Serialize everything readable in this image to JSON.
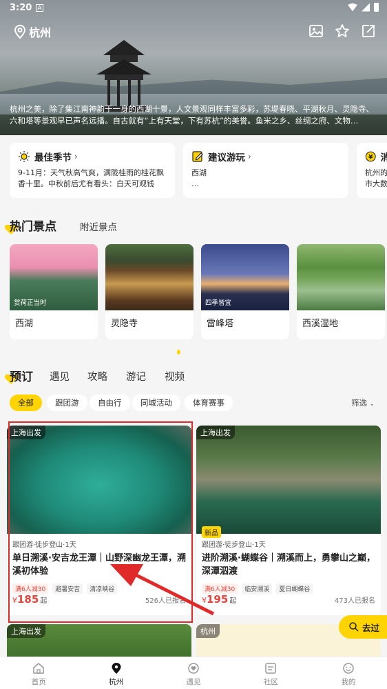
{
  "status": {
    "time": "3:20",
    "notif": "A"
  },
  "header": {
    "city": "杭州"
  },
  "hero": {
    "description": "杭州之美，除了集江南神韵于一身的西湖十景，人文景观同样丰富多彩，苏堤春晓、平湖秋月、灵隐寺、六和塔等景观早已声名远播。自古就有“上有天堂，下有苏杭”的美誉。鱼米之乡、丝绸之府、文物…"
  },
  "info_cards": [
    {
      "title": "最佳季节",
      "body": "9-11月：天气秋高气爽，满陇桂雨的桂花飘香十里。中秋前后尤有看头：白天可观钱塘…",
      "icon": "sun-icon"
    },
    {
      "title": "建议游玩",
      "body": "西湖\n…",
      "icon": "note-icon"
    },
    {
      "title": "消",
      "body": "杭州的\n市大数",
      "icon": "yen-icon"
    }
  ],
  "hot": {
    "tab_active": "热门景点",
    "tab_other": "附近景点",
    "spots": [
      {
        "name": "西湖",
        "tag": "赏荷正当时"
      },
      {
        "name": "灵隐寺",
        "tag": ""
      },
      {
        "name": "雷峰塔",
        "tag": "四季皆宜"
      },
      {
        "name": "西溪湿地",
        "tag": ""
      }
    ]
  },
  "booking": {
    "tabs": [
      "预订",
      "遇见",
      "攻略",
      "游记",
      "视频"
    ],
    "filters": [
      "全部",
      "跟团游",
      "自由行",
      "同城活动",
      "体育赛事"
    ],
    "filter_label": "筛选"
  },
  "products": [
    {
      "origin": "上海出发",
      "meta": "跟团游·徒步登山·1天",
      "title": "单日溯溪·安吉龙王潭｜山野深幽龙王潭，溯溪初体验",
      "chips": [
        "满6人减30",
        "避暑安吉",
        "清凉峡谷"
      ],
      "price_symbol": "¥",
      "price": "185",
      "price_suffix": "起",
      "sold": "526人已报名"
    },
    {
      "origin": "上海出发",
      "new_tag": "新品",
      "meta": "跟团游·徒步登山·1天",
      "title": "进阶溯溪·蝴蝶谷｜溯溪而上，勇攀山之巅，深潭泅渡",
      "chips": [
        "满6人减30",
        "临安溯溪",
        "夏日蝴蝶谷"
      ],
      "price_symbol": "¥",
      "price": "195",
      "price_suffix": "起",
      "sold": "473人已报名"
    }
  ],
  "more_products": [
    {
      "origin": "上海出发"
    },
    {
      "origin": "杭州"
    }
  ],
  "float_button": "去过",
  "nav": [
    {
      "label": "首页",
      "icon": "home-icon"
    },
    {
      "label": "杭州",
      "icon": "location-pin-icon"
    },
    {
      "label": "遇见",
      "icon": "meet-icon"
    },
    {
      "label": "社区",
      "icon": "community-icon"
    },
    {
      "label": "我的",
      "icon": "profile-icon"
    }
  ],
  "colors": {
    "accent": "#ffd400",
    "price": "#e8443a",
    "highlight_box": "#e02a2a"
  }
}
